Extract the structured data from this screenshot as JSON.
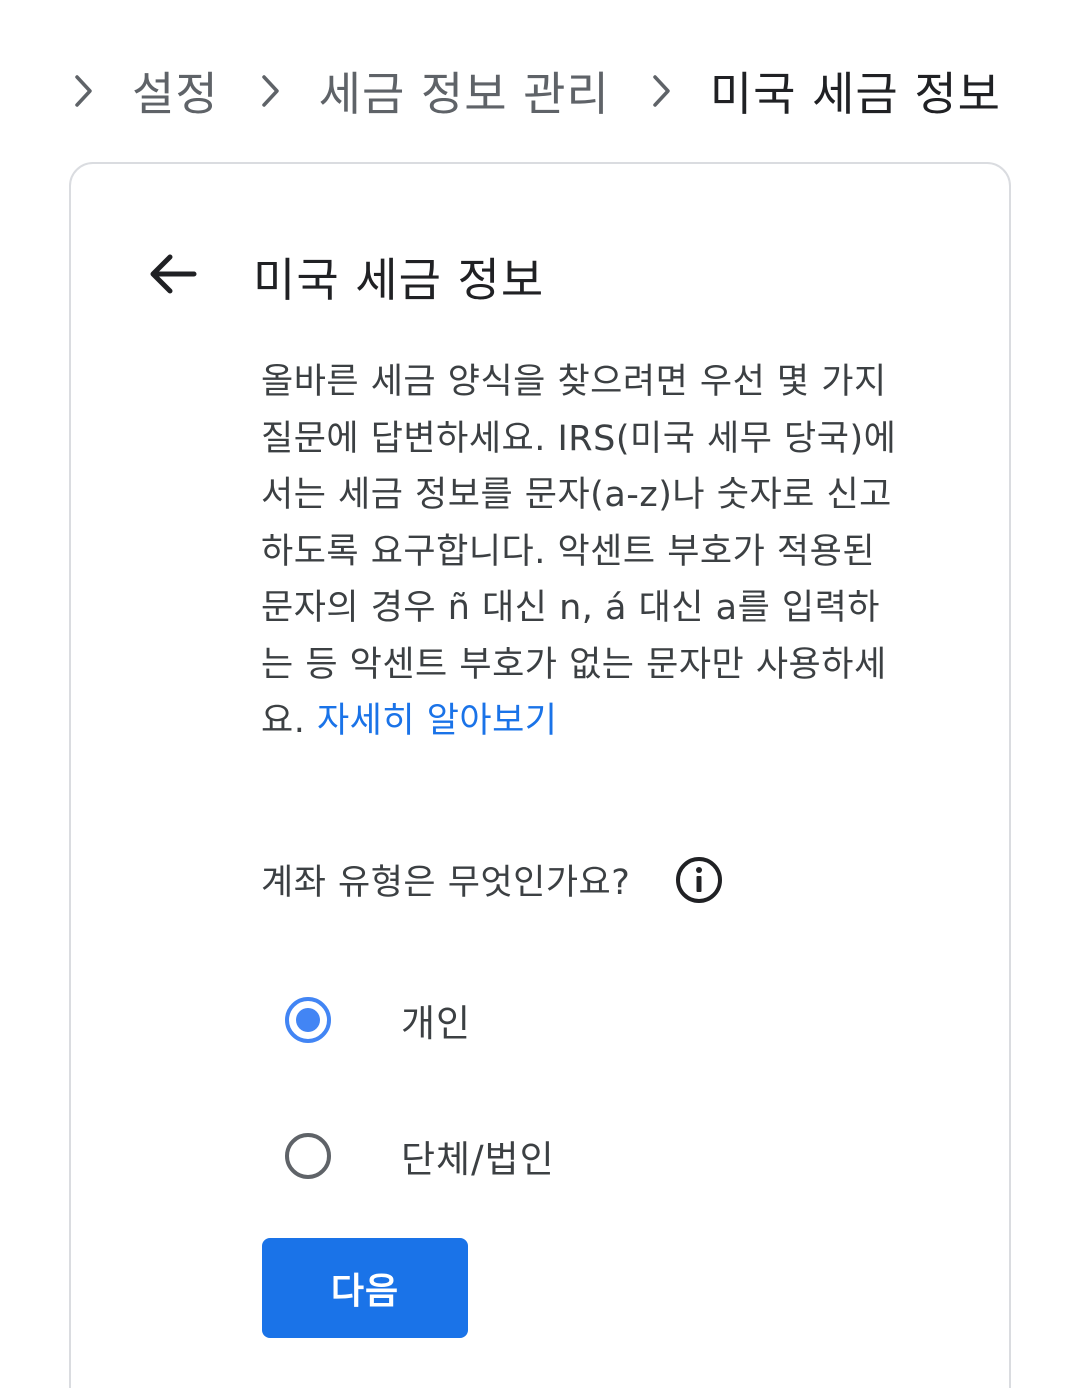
{
  "breadcrumb": {
    "items": [
      {
        "label": "설정"
      },
      {
        "label": "세금 정보 관리"
      },
      {
        "label": "미국 세금 정보"
      }
    ]
  },
  "card": {
    "title": "미국 세금 정보",
    "description": "올바른 세금 양식을 찾으려면 우선 몇 가지 질문에 답변하세요. IRS(미국 세무 당국)에서는 세금 정보를 문자(a-z)나 숫자로 신고하도록 요구합니다. 악센트 부호가 적용된 문자의 경우 ñ 대신 n, á 대신 a를 입력하는 등 악센트 부호가 없는 문자만 사용하세요.",
    "learn_more": "자세히 알아보기",
    "question": "계좌 유형은 무엇인가요?",
    "options": [
      {
        "label": "개인",
        "selected": true
      },
      {
        "label": "단체/법인",
        "selected": false
      }
    ],
    "next_label": "다음"
  },
  "colors": {
    "accent": "#1a73e8",
    "radio_selected": "#4285f4",
    "text_primary": "#202124",
    "text_secondary": "#5f6368"
  }
}
